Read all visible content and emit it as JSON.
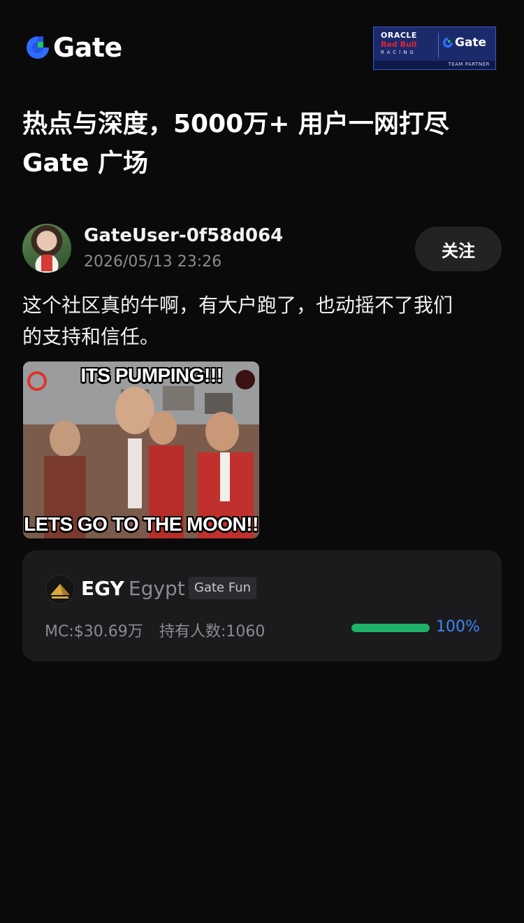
{
  "header": {
    "logo_text": "Gate",
    "partner_badge": {
      "oracle": "ORACLE",
      "redbull": "Red Bull",
      "racing": "RACING",
      "brand": "Gate",
      "strip": "TEAM PARTNER"
    }
  },
  "headline": {
    "line1": "热点与深度，5000万+ 用户一网打尽",
    "line2": "Gate 广场"
  },
  "post": {
    "username": "GateUser-0f58d064",
    "timestamp": "2026/05/13 23:26",
    "follow_label": "关注",
    "text_line1": "这个社区真的牛啊，有大户跑了，也动摇不了我们",
    "text_line2": "的支持和信任。",
    "meme": {
      "caption_top": "ITS PUMPING!!!",
      "caption_bottom": "LETS GO TO THE MOON!!"
    }
  },
  "token_card": {
    "symbol": "EGY",
    "name": "Egypt",
    "tag": "Gate Fun",
    "market_cap": "MC:$30.69万",
    "holders": "持有人数:1060",
    "progress_value": 1.0,
    "progress_label": "100%",
    "progress_color": "#20b26b",
    "percent_color": "#3a86f5"
  }
}
